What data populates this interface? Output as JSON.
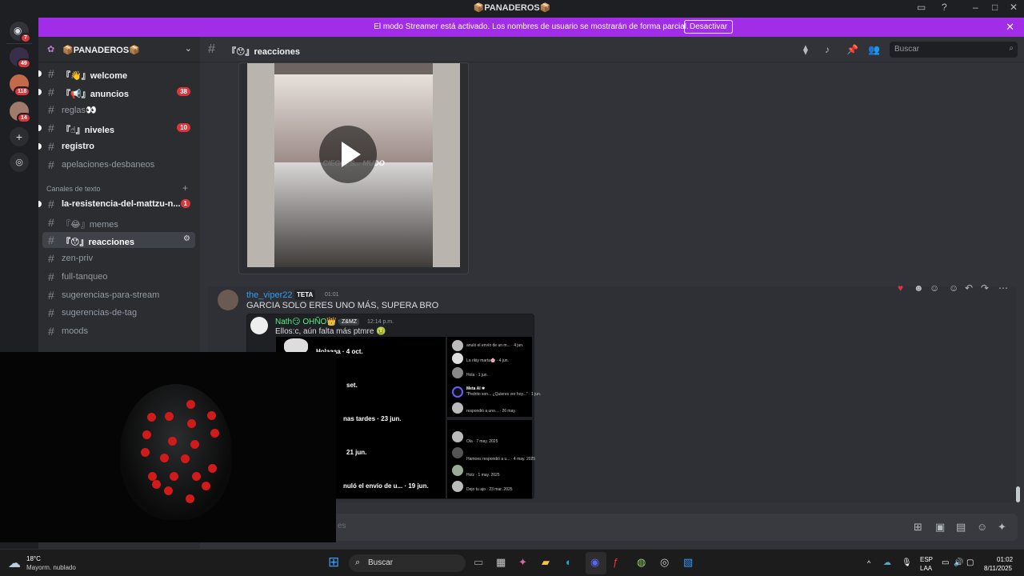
{
  "window": {
    "title": "📦PANADEROS📦"
  },
  "banner": {
    "text": "El modo Streamer está activado. Los nombres de usuario se mostrarán de forma parcial.",
    "button": "Desactivar"
  },
  "rail": {
    "badges": [
      "7",
      "49",
      "118",
      "14"
    ]
  },
  "server": {
    "name": "📦PANADEROS📦"
  },
  "channels": [
    {
      "label": "『👋』welcome",
      "state": "unread",
      "badge": ""
    },
    {
      "label": "『📢』anuncios",
      "state": "unread",
      "badge": "38"
    },
    {
      "label": "reglas👀",
      "state": "read",
      "badge": ""
    },
    {
      "label": "『☝』niveles",
      "state": "unread",
      "badge": "10"
    },
    {
      "label": "registro",
      "state": "unread",
      "badge": ""
    },
    {
      "label": "apelaciones-desbaneos",
      "state": "read",
      "badge": ""
    }
  ],
  "category": {
    "label": "Canales de texto"
  },
  "channels2": [
    {
      "label": "la-resistencia-del-mattzu-n...",
      "state": "unread",
      "badge": "1"
    },
    {
      "label": "『😂』memes",
      "state": "read",
      "badge": ""
    },
    {
      "label": "『😯』reacciones",
      "state": "active",
      "badge": ""
    },
    {
      "label": "zen-priv",
      "state": "read",
      "badge": ""
    },
    {
      "label": "full-tanqueo",
      "state": "read",
      "badge": ""
    },
    {
      "label": "sugerencias-para-stream",
      "state": "read",
      "badge": ""
    },
    {
      "label": "sugerencias-de-tag",
      "state": "read",
      "badge": ""
    },
    {
      "label": "moods",
      "state": "read",
      "badge": ""
    }
  ],
  "topbar": {
    "channel": "『😯』reacciones",
    "search_placeholder": "Buscar"
  },
  "video": {
    "caption": "CIEGO, S... MUDO"
  },
  "message": {
    "author": "the_viper22",
    "role": "TETA",
    "time": "01:01",
    "text": "GARCIA SOLO ERES UNO MÁS, SUPERA BRO"
  },
  "embed": {
    "author": "Nath😏 OHÑO👑♀",
    "badge": "Z&MZ",
    "time": "12:14 p.m.",
    "text": "Ellos:c, aún falta más ptmre 🤢",
    "left_lines": [
      {
        "text": "Holaaaa · 4 oct."
      },
      {
        "text": "set."
      },
      {
        "text": "nas tardes · 23 jun."
      },
      {
        "text": "21 jun."
      },
      {
        "text": "nuló el envío de u... · 19 jun."
      }
    ],
    "right_top": [
      {
        "name": "anuló el envío de un m... · 4 jun."
      },
      {
        "name": "La rikiy marta🌸 · 4 jun."
      },
      {
        "name": "Hola · 1 jun."
      },
      {
        "name": "Meta AI ✱"
      },
      {
        "name": "\"Pedrito son... ¿Quieres ver hoy...\" · 1 jun."
      },
      {
        "name": "respondió a uno... · 26 may."
      }
    ],
    "right_bottom": [
      {
        "name": "Ola · 7 may. 2025"
      },
      {
        "name": "Hamoes respondió a u... · 4 may. 2025"
      },
      {
        "name": "Holz · 1 may. 2025"
      },
      {
        "name": "Dejo tu ajo · 23 mar. 2025"
      }
    ]
  },
  "composer": {
    "placeholder": "es"
  },
  "taskbar": {
    "weather_temp": "18°C",
    "weather_desc": "Mayorm. nublado",
    "search": "Buscar",
    "lang1": "ESP",
    "lang2": "LAA",
    "clock_time": "01:02",
    "clock_date": "8/11/2025"
  }
}
